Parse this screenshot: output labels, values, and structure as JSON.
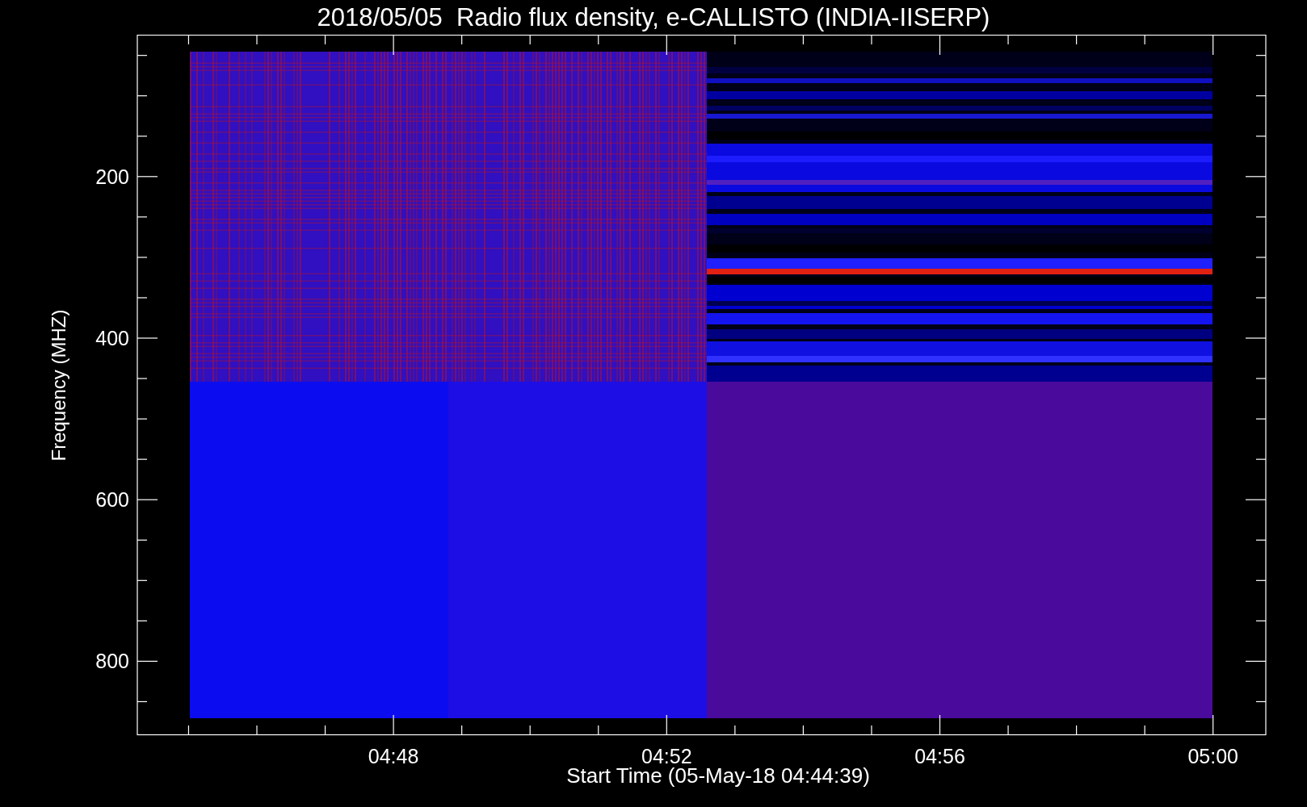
{
  "title": "2018/05/05  Radio flux density, e-CALLISTO (INDIA-IISERP)",
  "ylabel": "Frequency (MHZ)",
  "xlabel": "Start Time (05-May-18 04:44:39)",
  "yticks": [
    "200",
    "400",
    "600",
    "800"
  ],
  "xticks": [
    "04:48",
    "04:52",
    "04:56",
    "05:00"
  ]
}
